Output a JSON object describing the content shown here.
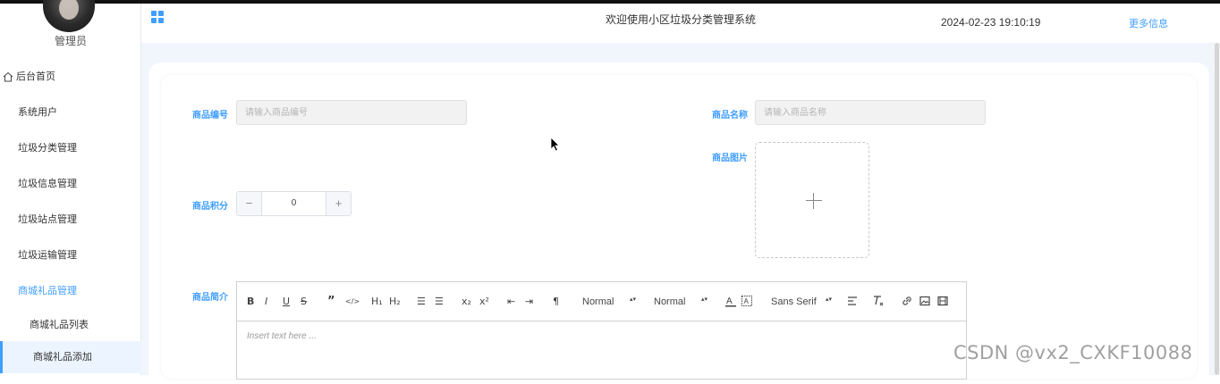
{
  "sidebar": {
    "role": "管理员",
    "items": [
      {
        "label": "后台首页",
        "icon": "home-icon"
      },
      {
        "label": "系统用户"
      },
      {
        "label": "垃圾分类管理"
      },
      {
        "label": "垃圾信息管理"
      },
      {
        "label": "垃圾站点管理"
      },
      {
        "label": "垃圾运输管理"
      },
      {
        "label": "商城礼品管理",
        "expanded": true
      }
    ],
    "submenu": [
      {
        "label": "商城礼品列表"
      },
      {
        "label": "商城礼品添加",
        "selected": true
      }
    ]
  },
  "header": {
    "title": "欢迎使用小区垃圾分类管理系统",
    "clock": "2024-02-23 19:10:19",
    "more_info": "更多信息"
  },
  "form": {
    "code_label": "商品编号",
    "code_placeholder": "请输入商品编号",
    "name_label": "商品名称",
    "name_placeholder": "请输入商品名称",
    "image_label": "商品图片",
    "points_label": "商品积分",
    "points_value": "0",
    "desc_label": "商品简介"
  },
  "editor": {
    "toolbar": {
      "bold": "B",
      "italic": "I",
      "underline": "U",
      "strike": "S",
      "blockquote": "”",
      "code": "</>",
      "h1": "H₁",
      "h2": "H₂",
      "ordered_list": "☰",
      "bullet_list": "☰",
      "sub": "x₂",
      "sup": "x²",
      "indent_dec": "⇤",
      "indent_inc": "⇥",
      "direction": "¶",
      "size_select": "Normal",
      "header_select": "Normal",
      "font_select": "Sans Serif",
      "caret": "▴▾"
    },
    "placeholder": "Insert text here ..."
  },
  "watermark": "CSDN @vx2_CXKF10088",
  "colors": {
    "accent": "#409eff",
    "background": "#f0f6fb"
  }
}
